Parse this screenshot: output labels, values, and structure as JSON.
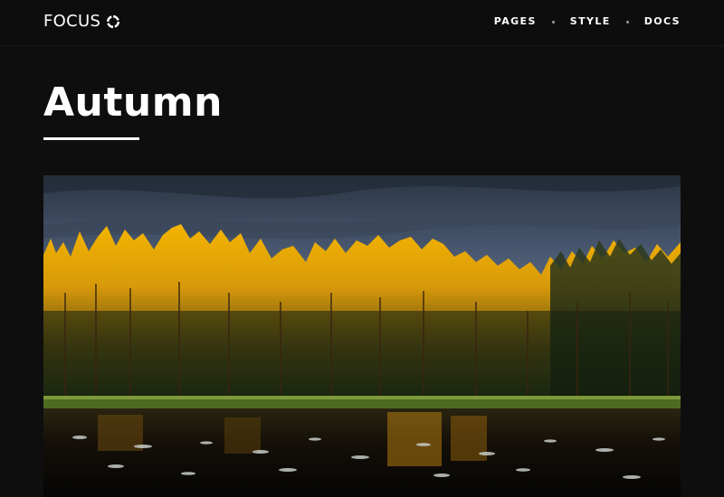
{
  "header": {
    "logo_text": "FOCUS",
    "logo_icon": "ring-icon",
    "nav": [
      {
        "label": "PAGES"
      },
      {
        "label": "STYLE"
      },
      {
        "label": "DOCS"
      }
    ]
  },
  "main": {
    "title": "Autumn",
    "hero_image": {
      "subject": "golden sunlit forest reflected in lake"
    }
  },
  "colors": {
    "background": "#0e0e0e",
    "text": "#ffffff",
    "separator": "#9a9a9a"
  }
}
